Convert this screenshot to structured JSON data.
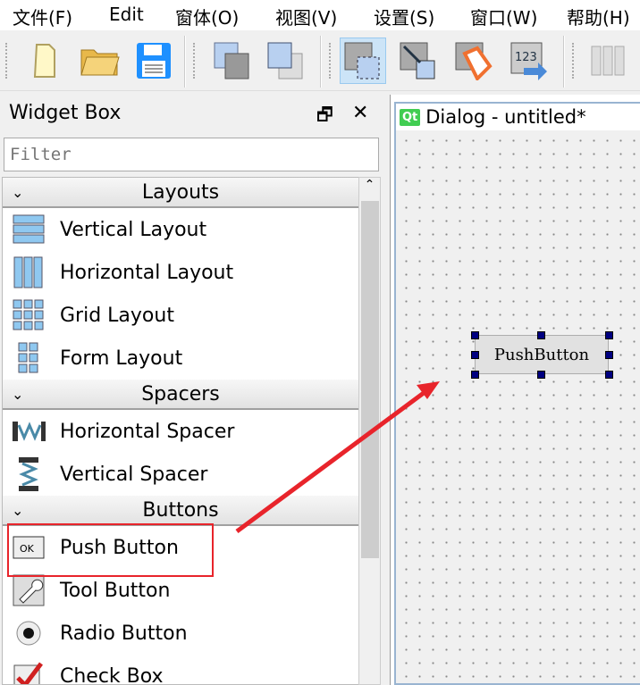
{
  "menu": [
    "文件(F)",
    "Edit",
    "窗体(O)",
    "视图(V)",
    "设置(S)",
    "窗口(W)",
    "帮助(H)"
  ],
  "widget_box": {
    "title": "Widget Box",
    "float_icon": "float-icon",
    "close_icon": "close-icon",
    "filter_placeholder": "Filter",
    "categories": [
      {
        "label": "Layouts",
        "items": [
          "Vertical Layout",
          "Horizontal Layout",
          "Grid Layout",
          "Form Layout"
        ]
      },
      {
        "label": "Spacers",
        "items": [
          "Horizontal Spacer",
          "Vertical Spacer"
        ]
      },
      {
        "label": "Buttons",
        "items": [
          "Push Button",
          "Tool Button",
          "Radio Button",
          "Check Box"
        ]
      }
    ]
  },
  "form": {
    "logo": "Qt",
    "title": "Dialog - untitled*",
    "push_button": "PushButton"
  },
  "annotation_color": "#e8242b"
}
